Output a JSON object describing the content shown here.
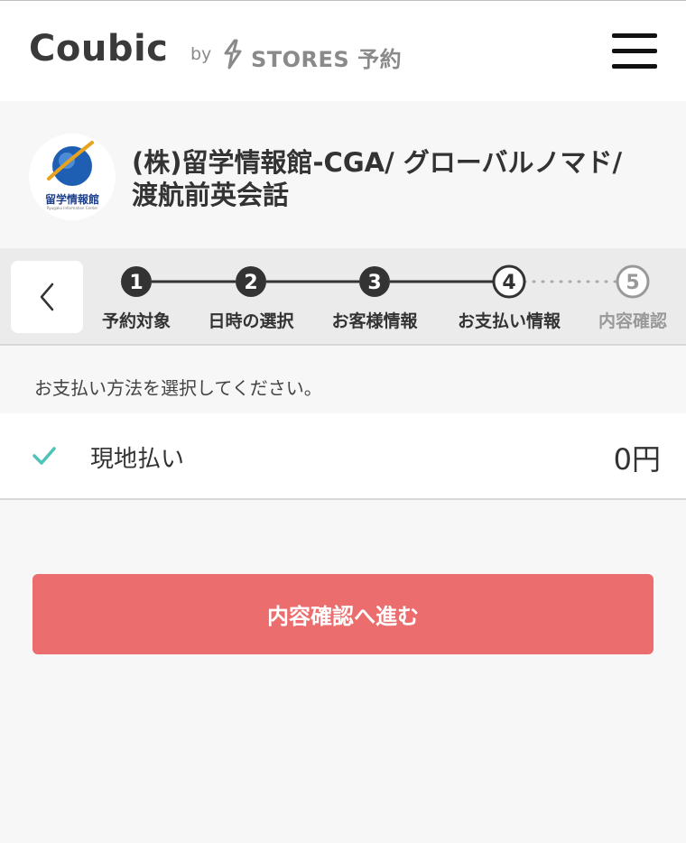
{
  "header": {
    "logo": "Coubic",
    "by": "by",
    "stores": "STORES 予約"
  },
  "shop": {
    "logo_text": "留学情報館",
    "logo_subtext": "Ryugaku Information Center",
    "name_line1": "(株)留学情報館-CGA/ グローバルノマド/",
    "name_line2": "渡航前英会話"
  },
  "steps": [
    {
      "number": "1",
      "label": "予約対象",
      "state": "done"
    },
    {
      "number": "2",
      "label": "日時の選択",
      "state": "done"
    },
    {
      "number": "3",
      "label": "お客様情報",
      "state": "done"
    },
    {
      "number": "4",
      "label": "お支払い情報",
      "state": "current"
    },
    {
      "number": "5",
      "label": "内容確認",
      "state": "future"
    }
  ],
  "instruction": "お支払い方法を選択してください。",
  "payment": {
    "name": "現地払い",
    "price": "0円",
    "selected": true
  },
  "next_button": "内容確認へ進む",
  "colors": {
    "accent": "#ec6d6d",
    "check": "#4ec3b8",
    "step_dark": "#333333",
    "step_future": "#999999"
  }
}
